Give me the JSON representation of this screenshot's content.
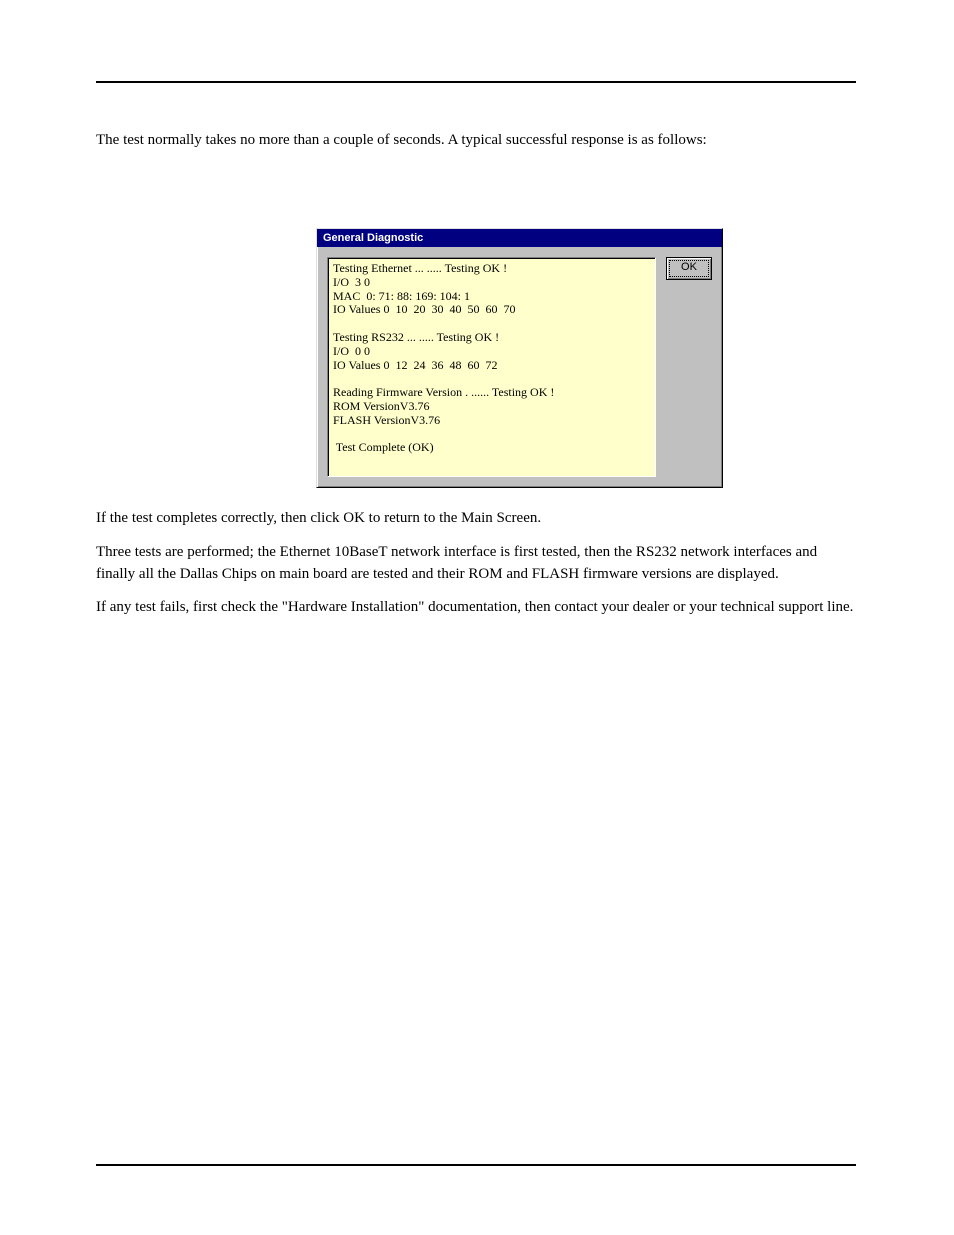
{
  "intro": {
    "p1": "The test normally takes no more than a couple of seconds. A typical successful response is as follows:"
  },
  "dialog": {
    "title": "General Diagnostic",
    "ok_label": "OK",
    "lines": [
      "Testing Ethernet ... ..... Testing OK !",
      "I/O  3 0",
      "MAC  0: 71: 88: 169: 104: 1",
      "IO Values 0  10  20  30  40  50  60  70",
      "",
      "Testing RS232 ... ..... Testing OK !",
      "I/O  0 0",
      "IO Values 0  12  24  36  48  60  72",
      "",
      "Reading Firmware Version . ...... Testing OK !",
      "ROM VersionV3.76",
      "FLASH VersionV3.76",
      "",
      " Test Complete (OK)"
    ]
  },
  "below": {
    "p1": "If the test completes correctly, then click OK to return to the Main Screen.",
    "p2": "Three tests are performed; the Ethernet 10BaseT network interface is first tested, then the RS232 network interfaces and finally all the Dallas Chips on main board are tested and their ROM and FLASH firmware versions are displayed.",
    "p3": "If any test fails, first check the \"Hardware Installation\" documentation, then contact your dealer or your technical support line."
  }
}
